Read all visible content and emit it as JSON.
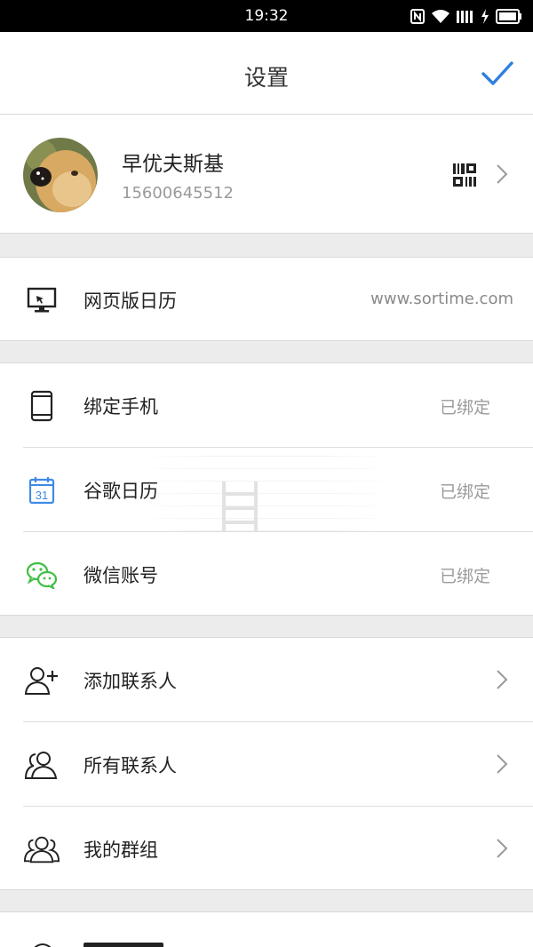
{
  "status_bar": {
    "time": "19:32"
  },
  "header": {
    "title": "设置"
  },
  "profile": {
    "name": "早优夫斯基",
    "phone": "15600645512"
  },
  "web_calendar": {
    "label": "网页版日历",
    "url": "www.sortime.com"
  },
  "bindings": [
    {
      "label": "绑定手机",
      "status": "已绑定",
      "icon": "phone-icon"
    },
    {
      "label": "谷歌日历",
      "status": "已绑定",
      "icon": "google-calendar-icon",
      "icon_text": "31"
    },
    {
      "label": "微信账号",
      "status": "已绑定",
      "icon": "wechat-icon"
    }
  ],
  "contacts": [
    {
      "label": "添加联系人",
      "icon": "add-contact-icon"
    },
    {
      "label": "所有联系人",
      "icon": "contacts-icon"
    },
    {
      "label": "我的群组",
      "icon": "group-icon"
    }
  ],
  "colors": {
    "accent_blue": "#2f7fe0",
    "wechat_green": "#3fbf45",
    "background": "#ececec"
  }
}
